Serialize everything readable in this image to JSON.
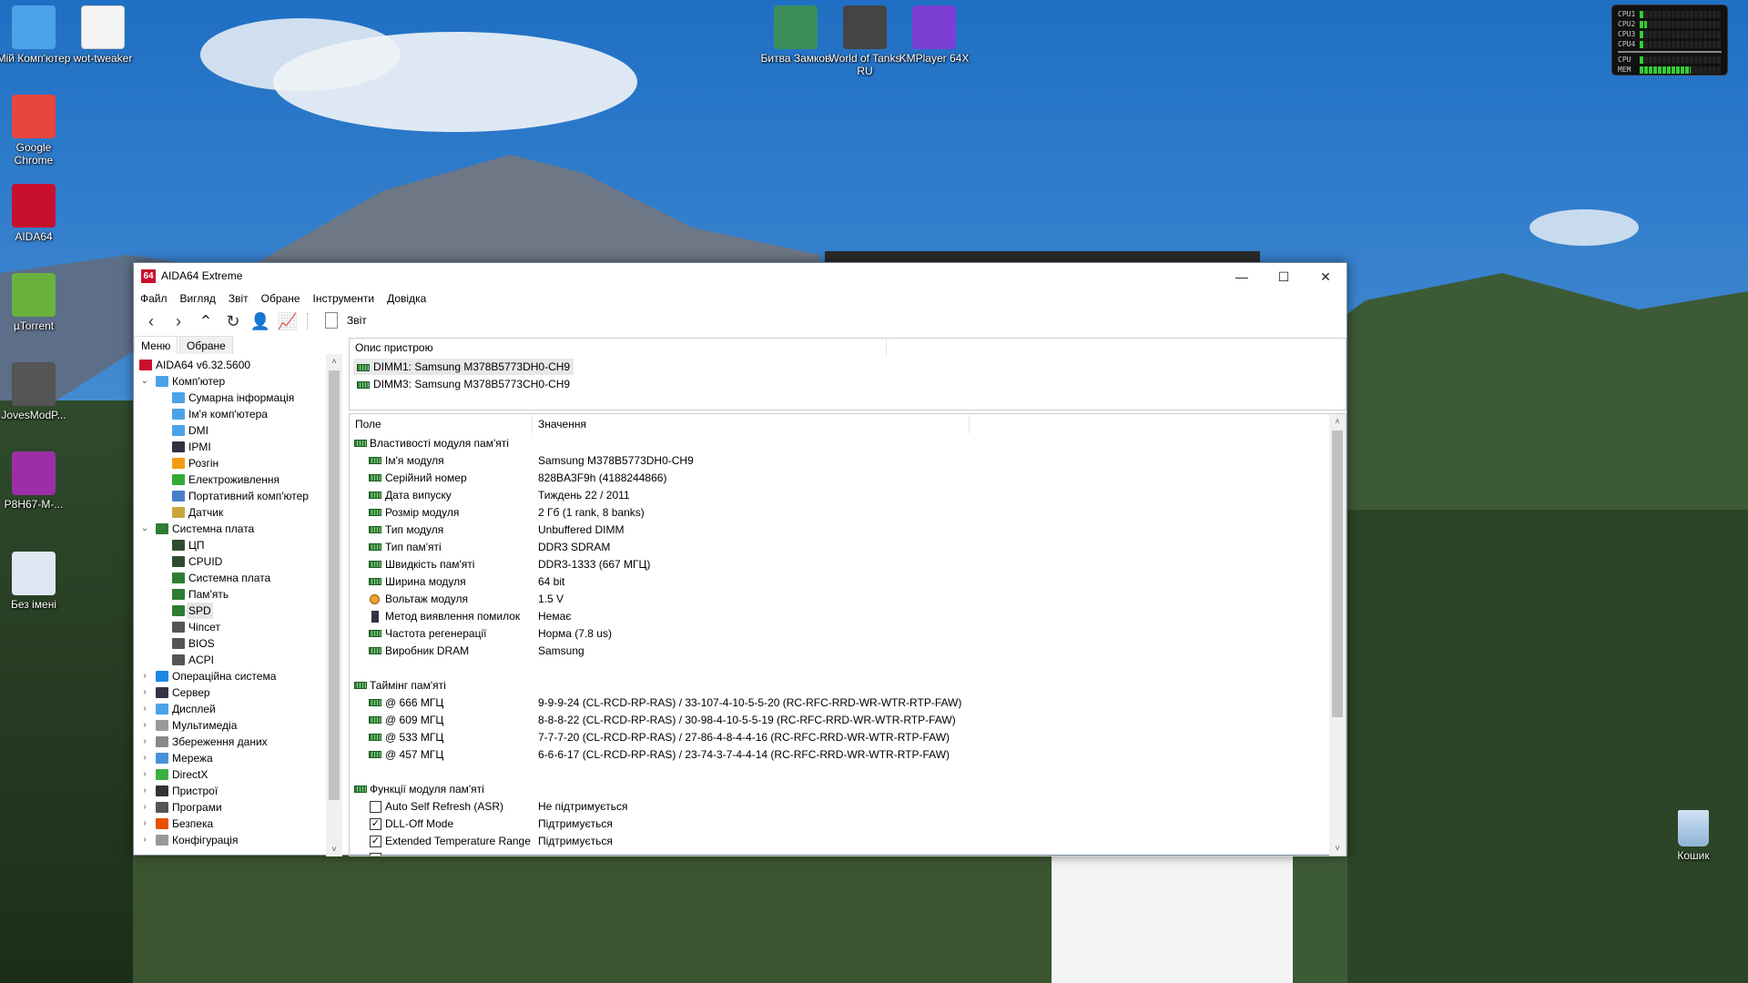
{
  "desktop": {
    "icons_left": [
      {
        "label": "Мій Комп'ютер",
        "icon": "computer-icon",
        "color": "#4aa3e8"
      },
      {
        "label": "Google Chrome",
        "icon": "chrome-icon",
        "color": "#e8453c"
      },
      {
        "label": "AIDA64",
        "icon": "aida64-icon",
        "color": "#c8102e"
      },
      {
        "label": "µTorrent",
        "icon": "utorrent-icon",
        "color": "#6ab23e"
      },
      {
        "label": "JovesModP...",
        "icon": "wot-modpack-icon",
        "color": "#555555"
      },
      {
        "label": "P8H67-M-...",
        "icon": "winrar-icon",
        "color": "#9c2fa8"
      },
      {
        "label": "Без імені",
        "icon": "image-file-icon",
        "color": "#dfe8f2"
      }
    ],
    "icon_wot_tweaker": {
      "label": "wot-tweaker",
      "icon": "document-icon",
      "color": "#f4f4f4"
    },
    "icons_top": [
      {
        "label": "Битва Замков",
        "icon": "castle-clash-icon",
        "color": "#3c8f5a"
      },
      {
        "label": "World of Tanks RU",
        "icon": "wot-icon",
        "color": "#444444"
      },
      {
        "label": "KMPlayer 64X",
        "icon": "kmplayer-icon",
        "color": "#7b3fd4"
      }
    ],
    "recycle_bin": {
      "label": "Кошик",
      "icon": "recycle-bin-icon"
    },
    "cpu_widget": {
      "rows": [
        {
          "label": "CPU1",
          "load": 4
        },
        {
          "label": "CPU2",
          "load": 9
        },
        {
          "label": "CPU3",
          "load": 3
        },
        {
          "label": "CPU4",
          "load": 4
        },
        {
          "label": "CPU",
          "load": 4
        },
        {
          "label": "MEM",
          "load": 62
        }
      ]
    }
  },
  "window": {
    "title": "AIDA64 Extreme",
    "controls": {
      "minimize": "—",
      "maximize": "☐",
      "close": "✕"
    },
    "menu": [
      "Файл",
      "Вигляд",
      "Звіт",
      "Обране",
      "Інструменти",
      "Довідка"
    ],
    "toolbar": {
      "report_label": "Звіт"
    },
    "tabs": [
      "Меню",
      "Обране"
    ],
    "tree": [
      {
        "label": "AIDA64 v6.32.5600",
        "level": 0,
        "icon": "aida64-icon",
        "color": "#c8102e"
      },
      {
        "label": "Комп'ютер",
        "level": 1,
        "expanded": true,
        "icon": "computer-icon",
        "color": "#4aa3e8"
      },
      {
        "label": "Сумарна інформація",
        "level": 2,
        "icon": "monitor-icon",
        "color": "#4aa3e8"
      },
      {
        "label": "Ім'я комп'ютера",
        "level": 2,
        "icon": "monitor-icon",
        "color": "#4aa3e8"
      },
      {
        "label": "DMI",
        "level": 2,
        "icon": "monitor-icon",
        "color": "#4aa3e8"
      },
      {
        "label": "IPMI",
        "level": 2,
        "icon": "server-icon",
        "color": "#334"
      },
      {
        "label": "Розгін",
        "level": 2,
        "icon": "flame-icon",
        "color": "#f39c12"
      },
      {
        "label": "Електроживлення",
        "level": 2,
        "icon": "battery-icon",
        "color": "#3a3"
      },
      {
        "label": "Портативний комп'ютер",
        "level": 2,
        "icon": "laptop-icon",
        "color": "#4a7ec8"
      },
      {
        "label": "Датчик",
        "level": 2,
        "icon": "gauge-icon",
        "color": "#c9a63a"
      },
      {
        "label": "Системна плата",
        "level": 1,
        "expanded": true,
        "icon": "motherboard-icon",
        "color": "#2e7d32"
      },
      {
        "label": "ЦП",
        "level": 2,
        "icon": "chip-icon",
        "color": "#2e4d2e"
      },
      {
        "label": "CPUID",
        "level": 2,
        "icon": "chip-icon",
        "color": "#2e4d2e"
      },
      {
        "label": "Системна плата",
        "level": 2,
        "icon": "motherboard-icon",
        "color": "#2e7d32"
      },
      {
        "label": "Пам'ять",
        "level": 2,
        "icon": "memory-icon",
        "color": "#2e7d32"
      },
      {
        "label": "SPD",
        "level": 2,
        "icon": "memory-icon",
        "color": "#2e7d32",
        "selected": true
      },
      {
        "label": "Чіпсет",
        "level": 2,
        "icon": "chipset-icon",
        "color": "#555"
      },
      {
        "label": "BIOS",
        "level": 2,
        "icon": "chipset-icon",
        "color": "#555"
      },
      {
        "label": "ACPI",
        "level": 2,
        "icon": "chipset-icon",
        "color": "#555"
      },
      {
        "label": "Операційна система",
        "level": 1,
        "expanded": false,
        "icon": "windows-icon",
        "color": "#1e88e5"
      },
      {
        "label": "Сервер",
        "level": 1,
        "expanded": false,
        "icon": "server-icon",
        "color": "#334"
      },
      {
        "label": "Дисплей",
        "level": 1,
        "expanded": false,
        "icon": "display-icon",
        "color": "#4aa3e8"
      },
      {
        "label": "Мультимедіа",
        "level": 1,
        "expanded": false,
        "icon": "speaker-icon",
        "color": "#999"
      },
      {
        "label": "Збереження даних",
        "level": 1,
        "expanded": false,
        "icon": "storage-icon",
        "color": "#888"
      },
      {
        "label": "Мережа",
        "level": 1,
        "expanded": false,
        "icon": "network-icon",
        "color": "#4a90d9"
      },
      {
        "label": "DirectX",
        "level": 1,
        "expanded": false,
        "icon": "directx-icon",
        "color": "#3cb043"
      },
      {
        "label": "Пристрої",
        "level": 1,
        "expanded": false,
        "icon": "devices-icon",
        "color": "#333"
      },
      {
        "label": "Програми",
        "level": 1,
        "expanded": false,
        "icon": "programs-icon",
        "color": "#555"
      },
      {
        "label": "Безпека",
        "level": 1,
        "expanded": false,
        "icon": "shield-icon",
        "color": "#e65100"
      },
      {
        "label": "Конфігурація",
        "level": 1,
        "expanded": false,
        "icon": "config-icon",
        "color": "#999"
      }
    ],
    "device_pane": {
      "header": "Опис пристрою",
      "devices": [
        {
          "label": "DIMM1: Samsung M378B5773DH0-CH9",
          "selected": true
        },
        {
          "label": "DIMM3: Samsung M378B5773CH0-CH9"
        }
      ]
    },
    "props": {
      "columns": [
        "Поле",
        "Значення"
      ],
      "rows": [
        {
          "type": "group",
          "field": "Властивості модуля пам'яті"
        },
        {
          "field": "Ім'я модуля",
          "value": "Samsung M378B5773DH0-CH9"
        },
        {
          "field": "Серійний номер",
          "value": "828BA3F9h (4188244866)"
        },
        {
          "field": "Дата випуску",
          "value": "Тиждень 22 / 2011"
        },
        {
          "field": "Розмір модуля",
          "value": "2 Гб (1 rank, 8 banks)"
        },
        {
          "field": "Тип модуля",
          "value": "Unbuffered DIMM"
        },
        {
          "field": "Тип пам'яті",
          "value": "DDR3 SDRAM"
        },
        {
          "field": "Швидкість пам'яті",
          "value": "DDR3-1333 (667 МГЦ)"
        },
        {
          "field": "Ширина модуля",
          "value": "64 bit"
        },
        {
          "field": "Вольтаж модуля",
          "value": "1.5 V",
          "icon": "voltage-icon"
        },
        {
          "field": "Метод виявлення помилок",
          "value": "Немає",
          "icon": "ecc-icon"
        },
        {
          "field": "Частота регенерації",
          "value": "Норма (7.8 us)"
        },
        {
          "field": "Виробник DRAM",
          "value": "Samsung"
        },
        {
          "type": "blank"
        },
        {
          "type": "group",
          "field": "Таймінг пам'яті"
        },
        {
          "field": "@ 666 МГЦ",
          "value": "9-9-9-24  (CL-RCD-RP-RAS) / 33-107-4-10-5-5-20  (RC-RFC-RRD-WR-WTR-RTP-FAW)"
        },
        {
          "field": "@ 609 МГЦ",
          "value": "8-8-8-22  (CL-RCD-RP-RAS) / 30-98-4-10-5-5-19  (RC-RFC-RRD-WR-WTR-RTP-FAW)"
        },
        {
          "field": "@ 533 МГЦ",
          "value": "7-7-7-20  (CL-RCD-RP-RAS) / 27-86-4-8-4-4-16  (RC-RFC-RRD-WR-WTR-RTP-FAW)"
        },
        {
          "field": "@ 457 МГЦ",
          "value": "6-6-6-17  (CL-RCD-RP-RAS) / 23-74-3-7-4-4-14  (RC-RFC-RRD-WR-WTR-RTP-FAW)"
        },
        {
          "type": "blank"
        },
        {
          "type": "group",
          "field": "Функції модуля пам'яті"
        },
        {
          "field": "Auto Self Refresh (ASR)",
          "value": "Не підтримується",
          "checkbox": false
        },
        {
          "field": "DLL-Off Mode",
          "value": "Підтримується",
          "checkbox": true
        },
        {
          "field": "Extended Temperature Range",
          "value": "Підтримується",
          "checkbox": true
        },
        {
          "type": "partial",
          "checkbox": false
        }
      ]
    }
  }
}
